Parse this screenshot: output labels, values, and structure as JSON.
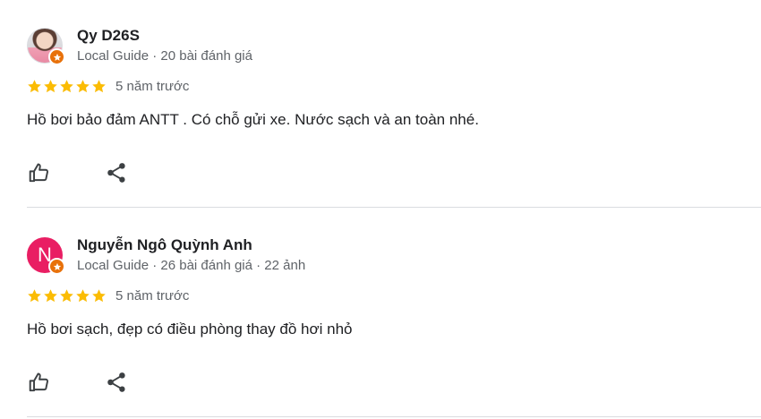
{
  "reviews": [
    {
      "name": "Qy D26S",
      "meta": "Local Guide · 20 bài đánh giá",
      "rating": 5,
      "date": "5 năm trước",
      "text": "Hồ bơi bảo đảm ANTT . Có chỗ gửi xe. Nước sạch và an toàn nhé.",
      "avatar_type": "photo"
    },
    {
      "name": "Nguyễn Ngô Quỳnh Anh",
      "meta": "Local Guide · 26 bài đánh giá · 22 ảnh",
      "rating": 5,
      "date": "5 năm trước",
      "text": "Hồ bơi sạch, đẹp có điều phòng thay đồ hơi nhỏ",
      "avatar_type": "letter",
      "avatar_letter": "N",
      "avatar_color": "#e91e63"
    }
  ],
  "icons": {
    "star": "star-icon",
    "like": "thumbs-up-icon",
    "share": "share-icon",
    "badge": "local-guide-star-icon"
  },
  "colors": {
    "star": "#fbbc04",
    "badge": "#e8710a",
    "divider": "#dadce0",
    "secondary_text": "#5f6368"
  }
}
